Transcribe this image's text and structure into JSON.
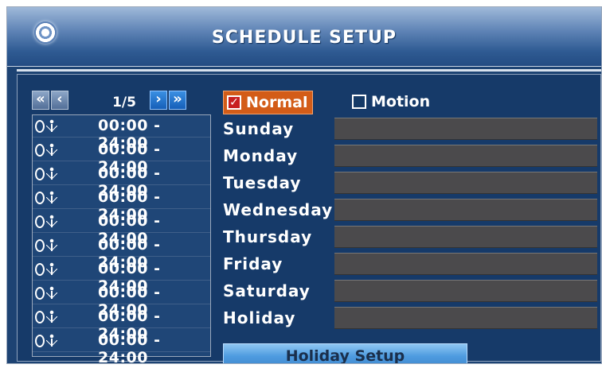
{
  "window": {
    "title": "SCHEDULE SETUP"
  },
  "toolbar": {
    "page_indicator": "1/5",
    "prev_first_label": "«",
    "prev_label": "‹",
    "next_label": "›",
    "next_last_label": "»"
  },
  "record_modes": [
    {
      "label": "Normal",
      "checked": true
    },
    {
      "label": "Motion",
      "checked": false
    }
  ],
  "time_rows": [
    "00:00 - 24:00",
    "00:00 - 24:00",
    "00:00 - 24:00",
    "00:00 - 24:00",
    "00:00 - 24:00",
    "00:00 - 24:00",
    "00:00 - 24:00",
    "00:00 - 24:00",
    "00:00 - 24:00",
    "00:00 - 24:00"
  ],
  "days": [
    "Sunday",
    "Monday",
    "Tuesday",
    "Wednesday",
    "Thursday",
    "Friday",
    "Saturday",
    "Holiday"
  ],
  "buttons": {
    "holiday_setup": "Holiday Setup"
  },
  "icons": {
    "logo": "disc-logo-icon",
    "row_clock": "clock-icon",
    "row_person": "person-icon",
    "checkbox_checked": "checkmark-icon"
  },
  "colors": {
    "window_bg": "#1d4373",
    "panel_bg": "#163a69",
    "accent_orange": "#d35c18",
    "bar_gray": "#4b4a4c",
    "button_blue": "#4f9ce0"
  }
}
